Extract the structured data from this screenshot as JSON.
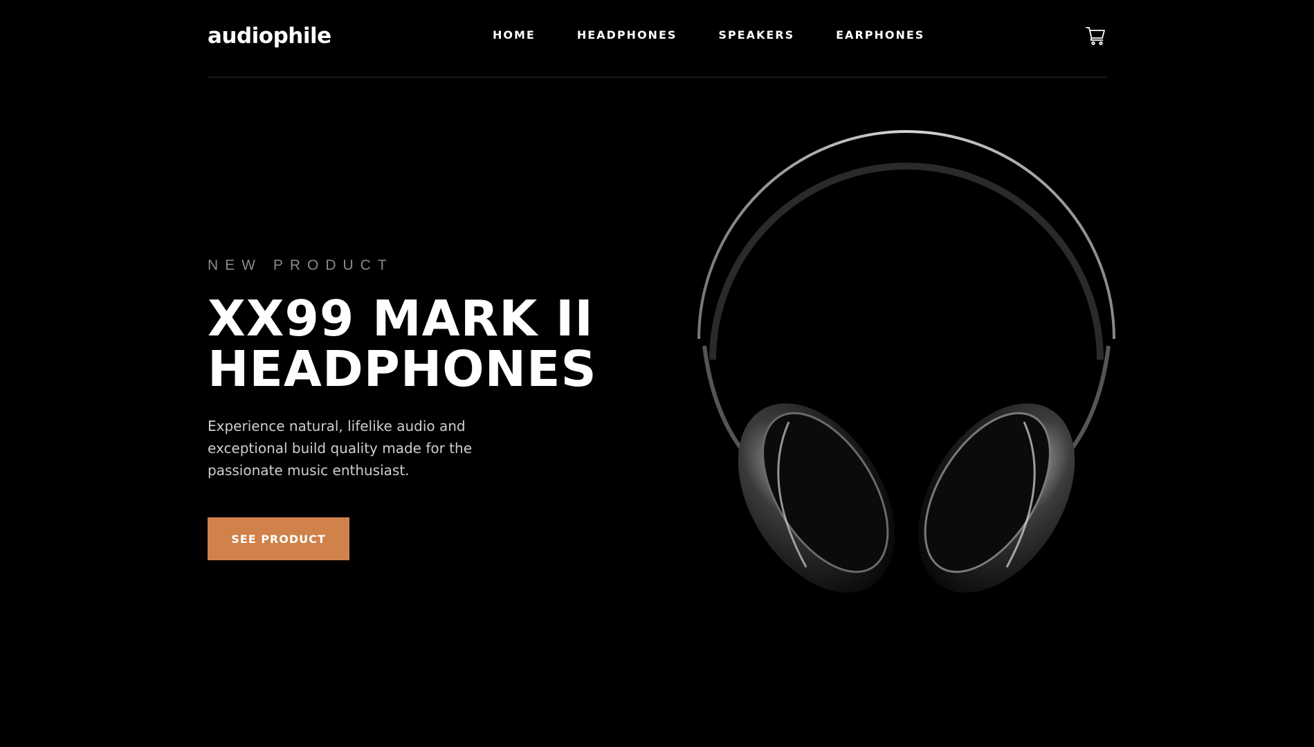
{
  "header": {
    "logo": "audiophile",
    "nav": [
      {
        "label": "HOME"
      },
      {
        "label": "HEADPHONES"
      },
      {
        "label": "SPEAKERS"
      },
      {
        "label": "EARPHONES"
      }
    ],
    "cart_icon": "cart-icon"
  },
  "hero": {
    "overline": "NEW PRODUCT",
    "title_line1": "XX99 MARK II",
    "title_line2": "HEADPHONES",
    "description": "Experience natural, lifelike audio and exceptional build quality made for the passionate music enthusiast.",
    "cta_label": "SEE PRODUCT",
    "image_icon": "headphones-image"
  },
  "colors": {
    "background": "#000000",
    "accent": "#D0824A",
    "text": "#FFFFFF",
    "muted": "#8A8A8A",
    "divider": "#2A2A2A"
  }
}
